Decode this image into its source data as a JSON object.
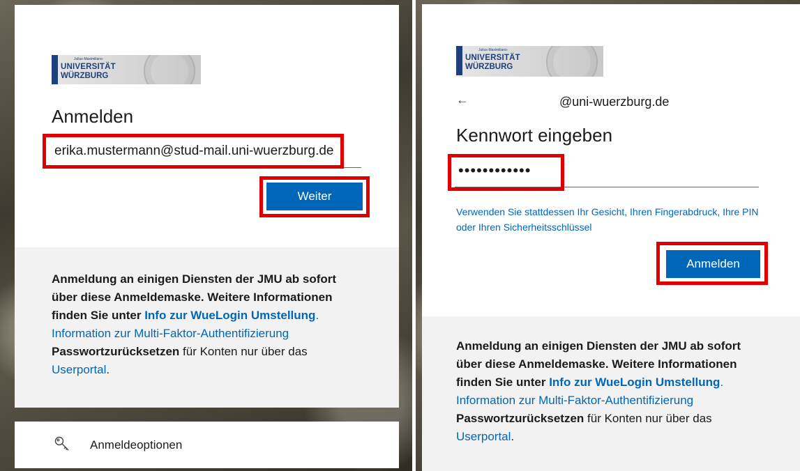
{
  "left": {
    "logo": {
      "small_text": "Julius-Maximilians-",
      "line1": "UNIVERSITÄT",
      "line2": "WÜRZBURG"
    },
    "heading": "Anmelden",
    "email_value": "erika.mustermann@stud-mail.uni-wuerzburg.de",
    "next_button": "Weiter",
    "footer": {
      "bold1": "Anmeldung an einigen Diensten der JMU ab sofort über diese Anmeldemaske. Weitere Informationen finden Sie unter",
      "link1": "Info zur WueLogin Umstellung",
      "dot": ".",
      "link2": "Information zur Multi-Faktor-Authentifizierung",
      "bold2": "Passwortzurücksetzen",
      "text1": "für Konten nur über das",
      "link3": "Userportal",
      "end": "."
    },
    "options_label": "Anmeldeoptionen"
  },
  "right": {
    "logo": {
      "small_text": "Julius-Maximilians-",
      "line1": "UNIVERSITÄT",
      "line2": "WÜRZBURG"
    },
    "back_arrow": "←",
    "email_identity": "@uni-wuerzburg.de",
    "heading": "Kennwort eingeben",
    "password_value": "••••••••••••",
    "alt_signin_link": "Verwenden Sie stattdessen Ihr Gesicht, Ihren Fingerabdruck, Ihre PIN oder Ihren Sicherheitsschlüssel",
    "signin_button": "Anmelden",
    "footer": {
      "bold1": "Anmeldung an einigen Diensten der JMU ab sofort über diese Anmeldemaske. Weitere Informationen finden Sie unter",
      "link1": "Info zur WueLogin Umstellung",
      "dot": ".",
      "link2": "Information zur Multi-Faktor-Authentifizierung",
      "bold2": "Passwortzurücksetzen",
      "text1": "für Konten nur über das",
      "link3": "Userportal",
      "end": "."
    }
  },
  "colors": {
    "primary_button": "#0067b8",
    "link": "#0067b8",
    "highlight": "#e00000",
    "brand_blue": "#1f3f7a"
  },
  "icons": {
    "options_icon": "key-icon",
    "back_icon": "back-arrow-icon"
  }
}
